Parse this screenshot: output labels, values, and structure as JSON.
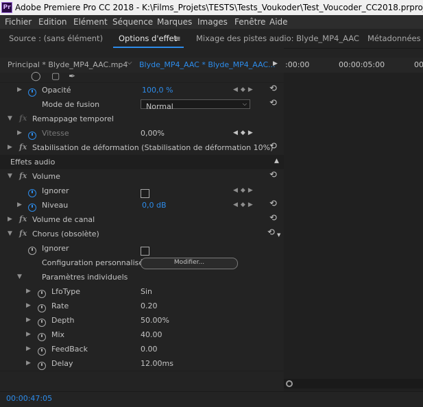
{
  "window": {
    "app_icon": "Pr",
    "title": "Adobe Premiere Pro CC 2018 - K:\\Films_Projets\\TESTS\\Tests_Voukoder\\Test_Voucoder_CC2018.prproj *"
  },
  "menu": [
    "Fichier",
    "Edition",
    "Elément",
    "Séquence",
    "Marques",
    "Images",
    "Fenêtre",
    "Aide"
  ],
  "tabs": {
    "source": "Source : (sans élément)",
    "effect_options": "Options d'effet",
    "audio_mixer": "Mixage des pistes audio: Blyde_MP4_AAC",
    "metadata": "Métadonnées"
  },
  "source_bar": {
    "master": "Principal * Blyde_MP4_AAC.mp4",
    "sequence": "Blyde_MP4_AAC * Blyde_MP4_AAC...",
    "time_start": ":00:00",
    "time_mid": "00:00:05:00",
    "time_end": "00"
  },
  "effects": {
    "opacity": {
      "name": "Opacité",
      "value": "100,0 %"
    },
    "blend_mode": {
      "name": "Mode de fusion",
      "value": "Normal"
    },
    "time_remap": {
      "name": "Remappage temporel"
    },
    "speed": {
      "name": "Vitesse",
      "value": "0,00%"
    },
    "warp": {
      "name": "Stabilisation de déformation (Stabilisation de déformation 10%)"
    }
  },
  "audio_effects": {
    "header": "Effets audio",
    "volume": {
      "name": "Volume",
      "ignore_label": "Ignorer",
      "level_label": "Niveau",
      "level_value": "0,0 dB"
    },
    "channel_volume": {
      "name": "Volume de canal"
    },
    "chorus": {
      "name": "Chorus (obsolète)",
      "ignore_label": "Ignorer",
      "custom_setup_label": "Configuration personnalisée",
      "edit_button": "Modifier...",
      "individual_params": "Paramètres individuels",
      "params": [
        {
          "name": "LfoType",
          "value": "Sin"
        },
        {
          "name": "Rate",
          "value": "0.20"
        },
        {
          "name": "Depth",
          "value": "50.00%"
        },
        {
          "name": "Mix",
          "value": "40.00"
        },
        {
          "name": "FeedBack",
          "value": "0.00"
        },
        {
          "name": "Delay",
          "value": "12.00ms"
        }
      ]
    }
  },
  "footer": {
    "timecode": "00:00:47:05"
  },
  "colors": {
    "accent": "#2d8ceb",
    "panel_bg": "#232323"
  }
}
